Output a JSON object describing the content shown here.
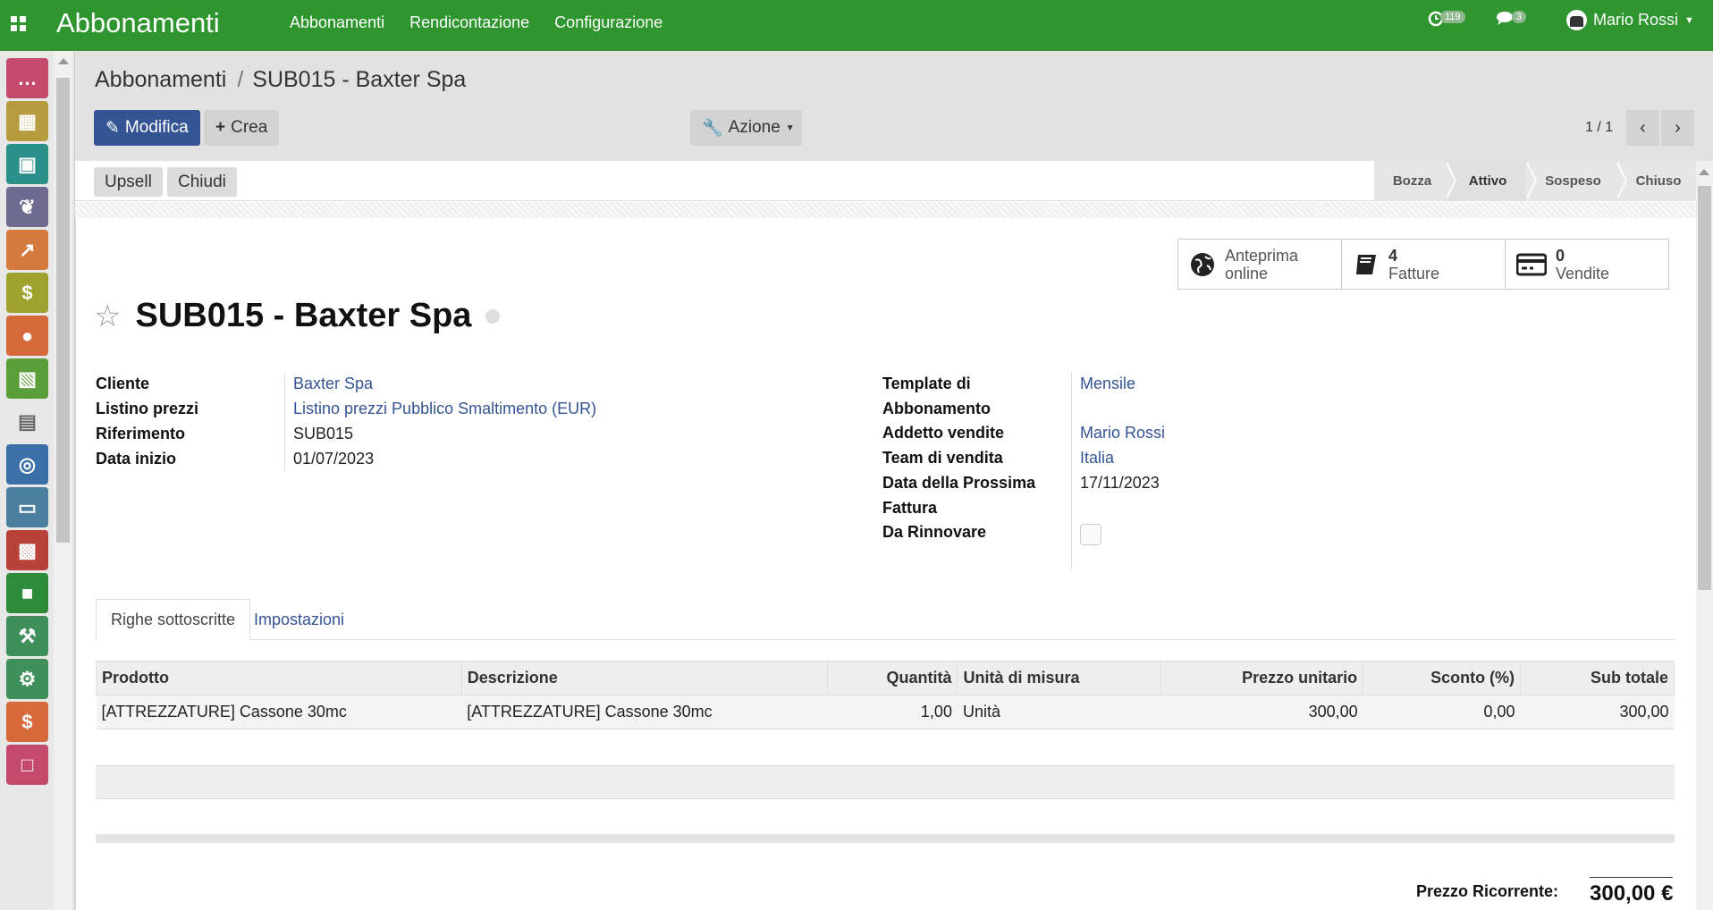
{
  "topbar": {
    "app_title": "Abbonamenti",
    "menu": [
      "Abbonamenti",
      "Rendicontazione",
      "Configurazione"
    ],
    "activity_count": "119",
    "message_count": "3",
    "user_name": "Mario Rossi",
    "brand_color": "#2f962f"
  },
  "left_apps": [
    {
      "icon": "chat-icon",
      "color": "#c34a6b"
    },
    {
      "icon": "calendar-icon",
      "color": "#b79b3f"
    },
    {
      "icon": "contacts-icon",
      "color": "#2b8f8a"
    },
    {
      "icon": "handshake-icon",
      "color": "#6f6a8f"
    },
    {
      "icon": "chart-icon",
      "color": "#d57a3c"
    },
    {
      "icon": "subscription-icon",
      "color": "#9fa12f"
    },
    {
      "icon": "globe-icon",
      "color": "#d46a3a"
    },
    {
      "icon": "map-icon",
      "color": "#5a9e3a"
    },
    {
      "icon": "image-icon",
      "color": "#e8e8e8"
    },
    {
      "icon": "lifebuoy-icon",
      "color": "#3a6fa8"
    },
    {
      "icon": "card-icon",
      "color": "#4a7fa0"
    },
    {
      "icon": "box-icon",
      "color": "#b8423a"
    },
    {
      "icon": "truck-icon",
      "color": "#2e8b3a"
    },
    {
      "icon": "wrench-icon",
      "color": "#3f8f5a"
    },
    {
      "icon": "tools-icon",
      "color": "#3f8f5a"
    },
    {
      "icon": "invoice-icon",
      "color": "#d66a3a"
    },
    {
      "icon": "extra-icon",
      "color": "#c34a6b"
    }
  ],
  "breadcrumb": {
    "parent": "Abbonamenti",
    "current": "SUB015 - Baxter Spa"
  },
  "buttons": {
    "edit": "Modifica",
    "create": "Crea",
    "action": "Azione",
    "upsell": "Upsell",
    "close": "Chiudi"
  },
  "pager": "1 / 1",
  "stages": [
    "Bozza",
    "Attivo",
    "Sospeso",
    "Chiuso"
  ],
  "active_stage": "Attivo",
  "smart_buttons": [
    {
      "icon": "globe-icon",
      "line1": "Anteprima",
      "line2": "online"
    },
    {
      "icon": "book-icon",
      "line1": "4",
      "line2": "Fatture"
    },
    {
      "icon": "credit-card-icon",
      "line1": "0",
      "line2": "Vendite"
    }
  ],
  "record_title": "SUB015 - Baxter Spa",
  "left_fields": [
    {
      "label": "Cliente",
      "value": "Baxter Spa",
      "link": true
    },
    {
      "label": "Listino prezzi",
      "value": "Listino prezzi Pubblico Smaltimento (EUR)",
      "link": true
    },
    {
      "label": "Riferimento",
      "value": "SUB015",
      "link": false
    },
    {
      "label": "Data inizio",
      "value": "01/07/2023",
      "link": false
    }
  ],
  "right_fields": {
    "template_label_1": "Template di",
    "template_label_2": "Abbonamento",
    "template_value": "Mensile",
    "salesperson_label": "Addetto vendite",
    "salesperson_value": "Mario Rossi",
    "team_label": "Team di vendita",
    "team_value": "Italia",
    "next_invoice_label_1": "Data della Prossima",
    "next_invoice_label_2": "Fattura",
    "next_invoice_value": "17/11/2023",
    "renew_label": "Da Rinnovare",
    "renew_checked": false
  },
  "tabs": {
    "lines": "Righe sottoscritte",
    "settings": "Impostazioni"
  },
  "table": {
    "headers": [
      "Prodotto",
      "Descrizione",
      "Quantità",
      "Unità di misura",
      "Prezzo unitario",
      "Sconto (%)",
      "Sub totale"
    ],
    "rows": [
      [
        "[ATTREZZATURE] Cassone 30mc",
        "[ATTREZZATURE] Cassone 30mc",
        "1,00",
        "Unità",
        "300,00",
        "0,00",
        "300,00"
      ]
    ]
  },
  "total": {
    "label": "Prezzo Ricorrente:",
    "value": "300,00 €"
  }
}
